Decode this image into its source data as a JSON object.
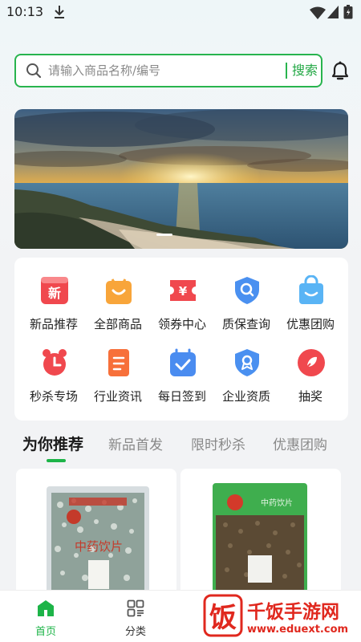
{
  "status_bar": {
    "time": "10:13"
  },
  "search": {
    "placeholder": "请输入商品名称/编号",
    "button_label": "搜索"
  },
  "menu": {
    "row1": [
      "新品推荐",
      "全部商品",
      "领券中心",
      "质保查询",
      "优惠团购"
    ],
    "row2": [
      "秒杀专场",
      "行业资讯",
      "每日签到",
      "企业资质",
      "抽奖"
    ]
  },
  "icon_text": {
    "new_badge": "新",
    "coupon_symbol": "¥"
  },
  "tabs": [
    "为你推荐",
    "新品首发",
    "限时秒杀",
    "优惠团购"
  ],
  "products": [
    {
      "package_label": "中药饮片"
    },
    {
      "package_label": "中药饮片"
    }
  ],
  "tabbar": {
    "home": "首页",
    "category": "分类"
  },
  "watermark": {
    "title": "千饭手游网",
    "url": "www.eduext.com",
    "logo_char": "饭"
  },
  "colors": {
    "accent": "#28b44e",
    "watermark": "#e0281e"
  }
}
